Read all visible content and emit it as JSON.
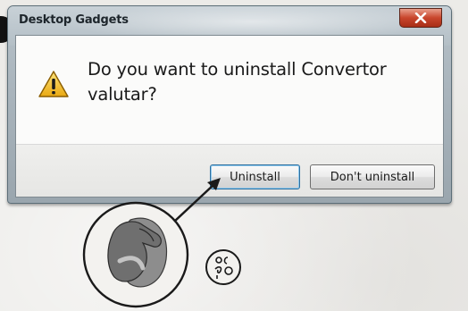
{
  "window": {
    "title": "Desktop Gadgets",
    "close_icon": "close-x-icon"
  },
  "dialog": {
    "icon": "warning-icon",
    "message": "Do you want to uninstall Convertor valutar?",
    "buttons": {
      "uninstall_label": "Uninstall",
      "dont_uninstall_label": "Don't uninstall"
    }
  },
  "annotation": {
    "pointer_icon": "hand-mouse-click-icon",
    "badge_icon": "click-symbol-icon"
  },
  "colors": {
    "title_bar": "#b4bfc6",
    "close_button": "#c8452c",
    "default_button_border": "#2e6f9e",
    "warning_yellow": "#f2c21a"
  }
}
